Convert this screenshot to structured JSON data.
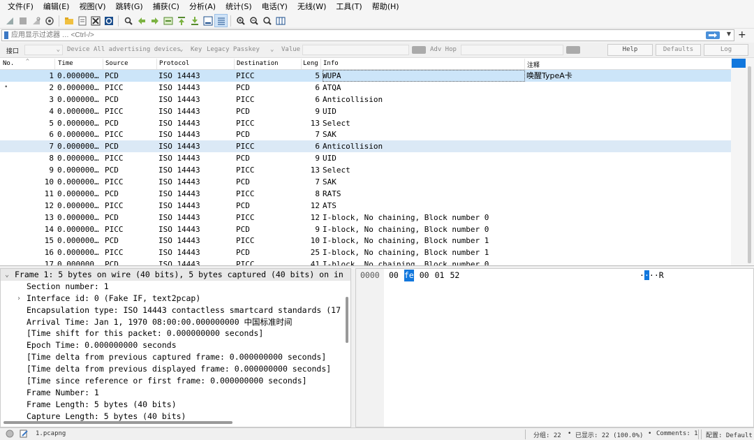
{
  "menu": [
    "文件(F)",
    "编辑(E)",
    "视图(V)",
    "跳转(G)",
    "捕获(C)",
    "分析(A)",
    "统计(S)",
    "电话(Y)",
    "无线(W)",
    "工具(T)",
    "帮助(H)"
  ],
  "filter": {
    "placeholder": "应用显示过滤器 … <Ctrl-/>",
    "plus": "+"
  },
  "ifbar": {
    "interface_label": "接口",
    "device_label": "Device",
    "device_value": "All advertising devices",
    "key_label": "Key",
    "key_value": "Legacy Passkey",
    "value_label": "Value",
    "adv_hop": "Adv Hop",
    "help": "Help",
    "defaults": "Defaults",
    "log": "Log"
  },
  "packet_list": {
    "columns": [
      "No.",
      "Time",
      "Source",
      "Protocol",
      "Destination",
      "Leng",
      "Info",
      "注释"
    ],
    "rows": [
      {
        "no": "1",
        "time": "0.000000…",
        "src": "PCD",
        "proto": "ISO 14443",
        "dst": "PICC",
        "len": "5",
        "info": "WUPA",
        "comment": "唤醒TypeA卡"
      },
      {
        "no": "2",
        "time": "0.000000…",
        "src": "PICC",
        "proto": "ISO 14443",
        "dst": "PCD",
        "len": "6",
        "info": "ATQA",
        "comment": ""
      },
      {
        "no": "3",
        "time": "0.000000…",
        "src": "PCD",
        "proto": "ISO 14443",
        "dst": "PICC",
        "len": "6",
        "info": "Anticollision",
        "comment": ""
      },
      {
        "no": "4",
        "time": "0.000000…",
        "src": "PICC",
        "proto": "ISO 14443",
        "dst": "PCD",
        "len": "9",
        "info": "UID",
        "comment": ""
      },
      {
        "no": "5",
        "time": "0.000000…",
        "src": "PCD",
        "proto": "ISO 14443",
        "dst": "PICC",
        "len": "13",
        "info": "Select",
        "comment": ""
      },
      {
        "no": "6",
        "time": "0.000000…",
        "src": "PICC",
        "proto": "ISO 14443",
        "dst": "PCD",
        "len": "7",
        "info": "SAK",
        "comment": ""
      },
      {
        "no": "7",
        "time": "0.000000…",
        "src": "PCD",
        "proto": "ISO 14443",
        "dst": "PICC",
        "len": "6",
        "info": "Anticollision",
        "comment": ""
      },
      {
        "no": "8",
        "time": "0.000000…",
        "src": "PICC",
        "proto": "ISO 14443",
        "dst": "PCD",
        "len": "9",
        "info": "UID",
        "comment": ""
      },
      {
        "no": "9",
        "time": "0.000000…",
        "src": "PCD",
        "proto": "ISO 14443",
        "dst": "PICC",
        "len": "13",
        "info": "Select",
        "comment": ""
      },
      {
        "no": "10",
        "time": "0.000000…",
        "src": "PICC",
        "proto": "ISO 14443",
        "dst": "PCD",
        "len": "7",
        "info": "SAK",
        "comment": ""
      },
      {
        "no": "11",
        "time": "0.000000…",
        "src": "PCD",
        "proto": "ISO 14443",
        "dst": "PICC",
        "len": "8",
        "info": "RATS",
        "comment": ""
      },
      {
        "no": "12",
        "time": "0.000000…",
        "src": "PICC",
        "proto": "ISO 14443",
        "dst": "PCD",
        "len": "12",
        "info": "ATS",
        "comment": ""
      },
      {
        "no": "13",
        "time": "0.000000…",
        "src": "PCD",
        "proto": "ISO 14443",
        "dst": "PICC",
        "len": "12",
        "info": "I-block, No chaining, Block number 0",
        "comment": ""
      },
      {
        "no": "14",
        "time": "0.000000…",
        "src": "PICC",
        "proto": "ISO 14443",
        "dst": "PCD",
        "len": "9",
        "info": "I-block, No chaining, Block number 0",
        "comment": ""
      },
      {
        "no": "15",
        "time": "0.000000…",
        "src": "PCD",
        "proto": "ISO 14443",
        "dst": "PICC",
        "len": "10",
        "info": "I-block, No chaining, Block number 1",
        "comment": ""
      },
      {
        "no": "16",
        "time": "0.000000…",
        "src": "PICC",
        "proto": "ISO 14443",
        "dst": "PCD",
        "len": "25",
        "info": "I-block, No chaining, Block number 1",
        "comment": ""
      },
      {
        "no": "17",
        "time": "0.000000…",
        "src": "PCD",
        "proto": "ISO 14443",
        "dst": "PICC",
        "len": "41",
        "info": "I-block, No chaining, Block number 0",
        "comment": ""
      }
    ]
  },
  "details": {
    "frame_line": "Frame 1: 5 bytes on wire (40 bits), 5 bytes captured (40 bits) on in",
    "children": [
      "Section number: 1",
      "Interface id: 0 (Fake IF, text2pcap)",
      "Encapsulation type: ISO 14443 contactless smartcard standards (17",
      "Arrival Time: Jan  1, 1970 08:00:00.000000000 中国标准时间",
      "[Time shift for this packet: 0.000000000 seconds]",
      "Epoch Time: 0.000000000 seconds",
      "[Time delta from previous captured frame: 0.000000000 seconds]",
      "[Time delta from previous displayed frame: 0.000000000 seconds]",
      "[Time since reference or first frame: 0.000000000 seconds]",
      "Frame Number: 1",
      "Frame Length: 5 bytes (40 bits)",
      "Capture Length: 5 bytes (40 bits)"
    ]
  },
  "bytes": {
    "offset": "0000",
    "hex": [
      "00",
      "fe",
      "00",
      "01",
      "52"
    ],
    "ascii": [
      "·",
      "·",
      "·",
      "·",
      "R"
    ]
  },
  "status": {
    "file": "1.pcapng",
    "packets": "分组: 22",
    "displayed": "已显示: 22 (100.0%)",
    "comments": "Comments: 1",
    "profile": "配置: Default"
  },
  "colors": {
    "selected_row": "#cce5f9",
    "highlight_row": "#dbe9f6",
    "accent": "#1177dd"
  }
}
